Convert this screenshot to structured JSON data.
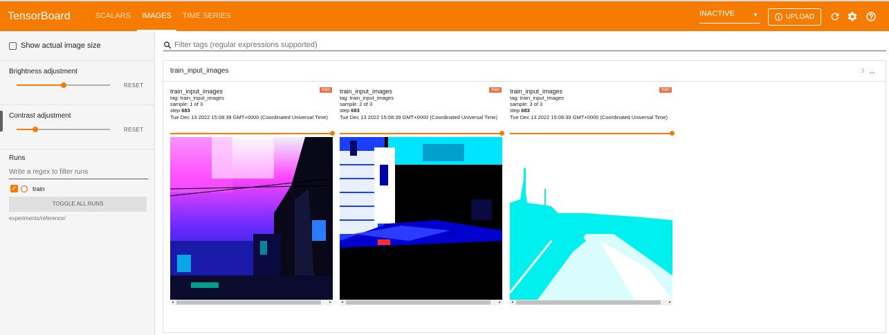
{
  "header": {
    "brand": "TensorBoard",
    "tabs": [
      "SCALARS",
      "IMAGES",
      "TIME SERIES"
    ],
    "active_tab": "IMAGES",
    "status": "INACTIVE",
    "upload_label": "UPLOAD",
    "icons": [
      "refresh-icon",
      "settings-icon",
      "help-icon"
    ],
    "accent_color": "#f57c00"
  },
  "sidebar": {
    "show_actual_size_label": "Show actual image size",
    "brightness_label": "Brightness adjustment",
    "brightness_value": 0.5,
    "contrast_label": "Contrast adjustment",
    "contrast_value": 0.2,
    "reset_label": "RESET",
    "runs_title": "Runs",
    "runs_filter_placeholder": "Write a regex to filter runs",
    "runs": [
      {
        "name": "train",
        "checked": true,
        "color": "#f4511e"
      }
    ],
    "toggle_all_label": "TOGGLE ALL RUNS",
    "logdir": "experiments/reference/"
  },
  "main": {
    "filter_placeholder": "Filter tags (regular expressions supported)",
    "card_title": "train_input_images",
    "card_count": "3",
    "panels": [
      {
        "title": "train_input_images",
        "tag": "tag: train_input_images",
        "sample": "sample: 1 of 3",
        "step_label": "step",
        "step": "683",
        "time": "Tue Dec 13 2022 15:08:39 GMT+0000 (Coordinated Universal Time)",
        "run": "train"
      },
      {
        "title": "train_input_images",
        "tag": "tag: train_input_images",
        "sample": "sample: 2 of 3",
        "step_label": "step",
        "step": "683",
        "time": "Tue Dec 13 2022 15:08:39 GMT+0000 (Coordinated Universal Time)",
        "run": "train"
      },
      {
        "title": "train_input_images",
        "tag": "tag: train_input_images",
        "sample": "sample: 3 of 3",
        "step_label": "step",
        "step": "683",
        "time": "Tue Dec 13 2022 15:08:39 GMT+0000 (Coordinated Universal Time)",
        "run": "train"
      }
    ]
  }
}
